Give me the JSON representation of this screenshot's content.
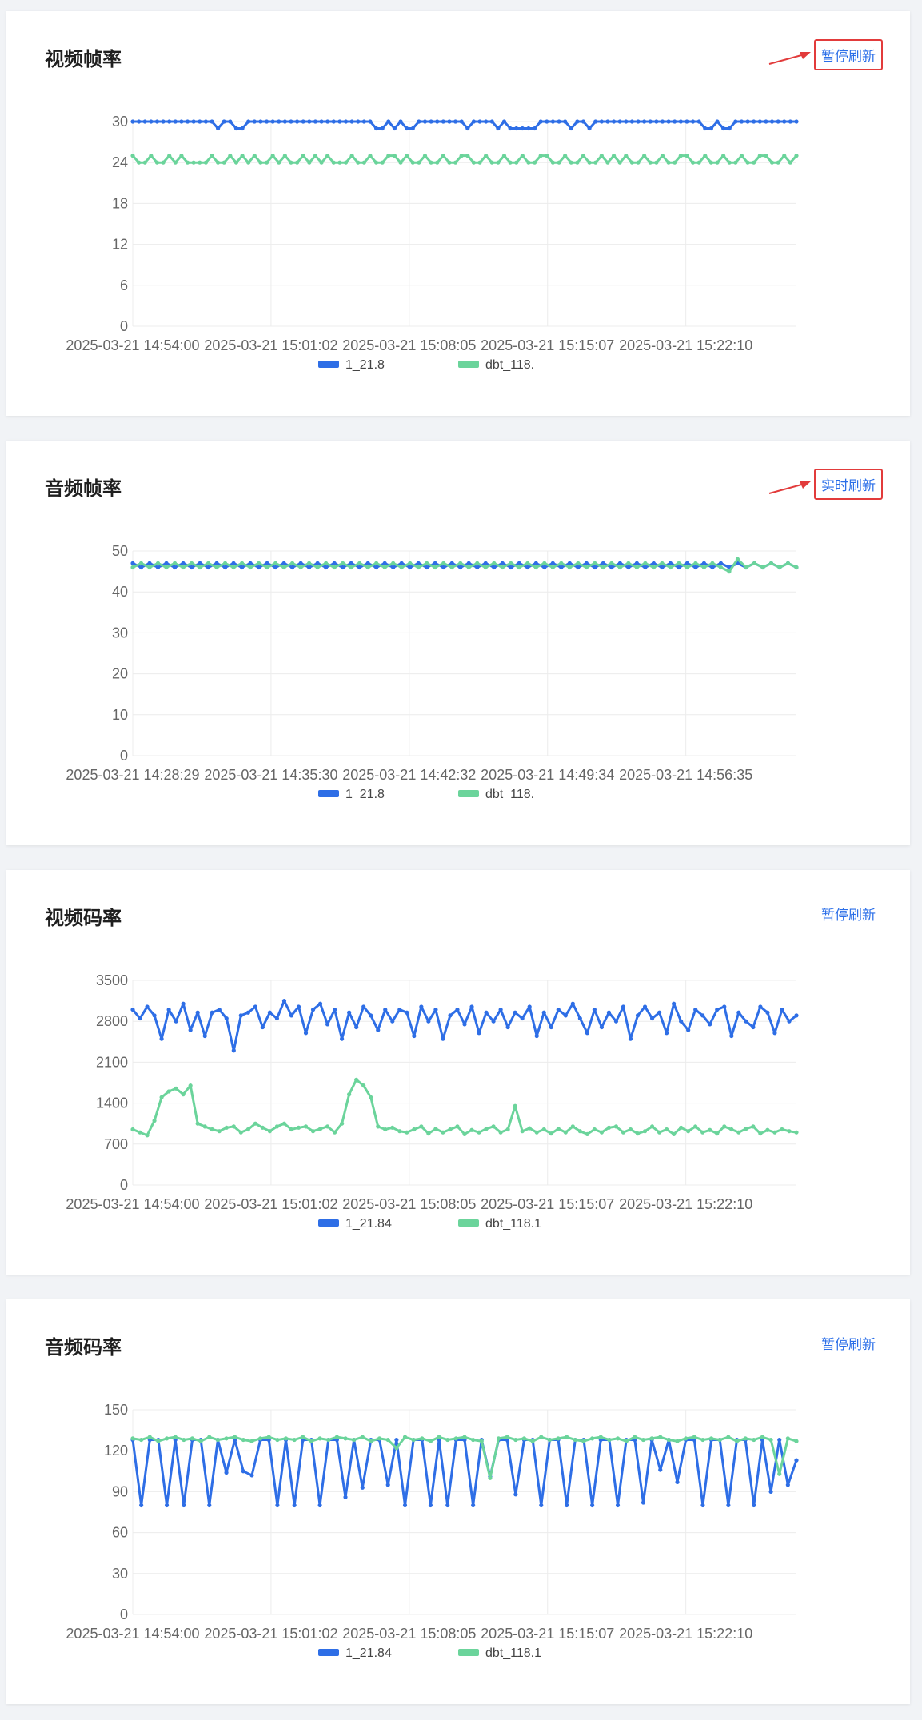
{
  "colors": {
    "series1": "#2e6ee6",
    "series2": "#6bd49b",
    "grid": "#ececec",
    "axis_text": "#666666",
    "accent": "#2a6ee8",
    "highlight": "#e23b3b"
  },
  "legend": [
    "1_21.8",
    "dbt_118."
  ],
  "panels": [
    {
      "title": "视频帧率",
      "button": "暂停刷新",
      "highlight": true
    },
    {
      "title": "音频帧率",
      "button": "实时刷新",
      "highlight": true
    },
    {
      "title": "视频码率",
      "button": "暂停刷新",
      "highlight": false
    },
    {
      "title": "音频码率",
      "button": "暂停刷新",
      "highlight": false
    }
  ],
  "chart_data": [
    {
      "type": "line",
      "title": "视频帧率",
      "y_ticks": [
        0,
        6,
        12,
        18,
        24,
        30
      ],
      "ylim": [
        0,
        30
      ],
      "x_ticks": [
        "2025-03-21 14:54:00",
        "2025-03-21 15:01:02",
        "2025-03-21 15:08:05",
        "2025-03-21 15:15:07",
        "2025-03-21 15:22:10"
      ],
      "legend_position": "bottom",
      "series": [
        {
          "name": "1_21.8",
          "baseline": 30,
          "dip": 29,
          "dips": [
            0.13,
            0.155,
            0.162,
            0.37,
            0.375,
            0.38,
            0.39,
            0.41,
            0.42,
            0.5,
            0.55,
            0.57,
            0.575,
            0.585,
            0.6,
            0.61,
            0.66,
            0.69,
            0.86,
            0.87,
            0.89,
            0.895
          ]
        },
        {
          "name": "dbt_118.",
          "baseline": 25,
          "dip": 24,
          "dips": [
            0.01,
            0.02,
            0.04,
            0.05,
            0.06,
            0.08,
            0.09,
            0.1,
            0.11,
            0.13,
            0.14,
            0.16,
            0.17,
            0.19,
            0.2,
            0.22,
            0.24,
            0.25,
            0.27,
            0.28,
            0.3,
            0.31,
            0.32,
            0.34,
            0.35,
            0.37,
            0.38,
            0.4,
            0.42,
            0.43,
            0.45,
            0.46,
            0.48,
            0.49,
            0.51,
            0.52,
            0.54,
            0.55,
            0.57,
            0.58,
            0.6,
            0.61,
            0.63,
            0.64,
            0.66,
            0.67,
            0.69,
            0.7,
            0.72,
            0.73,
            0.75,
            0.76,
            0.78,
            0.79,
            0.81,
            0.82,
            0.84,
            0.85,
            0.87,
            0.88,
            0.9,
            0.91,
            0.93,
            0.94,
            0.96,
            0.97,
            0.99
          ]
        }
      ]
    },
    {
      "type": "line",
      "title": "音频帧率",
      "y_ticks": [
        0,
        10,
        20,
        30,
        40,
        50
      ],
      "ylim": [
        0,
        50
      ],
      "x_ticks": [
        "2025-03-21 14:28:29",
        "2025-03-21 14:35:30",
        "2025-03-21 14:42:32",
        "2025-03-21 14:49:34",
        "2025-03-21 14:56:35"
      ],
      "legend_position": "bottom",
      "series": [
        {
          "name": "1_21.8",
          "values": [
            47,
            46,
            47,
            46,
            47,
            46,
            47,
            46,
            47,
            46,
            47,
            46,
            47,
            46,
            47,
            46,
            47,
            46,
            47,
            46,
            47,
            46,
            47,
            46,
            47,
            46,
            47,
            46,
            47,
            46,
            47,
            46,
            47,
            46,
            47,
            46,
            47,
            46,
            47,
            46,
            47,
            46,
            47,
            46,
            47,
            46,
            47,
            46,
            47,
            46,
            47,
            46,
            47,
            46,
            47,
            46,
            47,
            46,
            47,
            46,
            47,
            46,
            47,
            46,
            47,
            46,
            47,
            46,
            47,
            46,
            47,
            46,
            47,
            46,
            47,
            46,
            47,
            46,
            47,
            46
          ]
        },
        {
          "name": "dbt_118.",
          "values": [
            46,
            47,
            46,
            47,
            46,
            47,
            46,
            47,
            46,
            47,
            46,
            47,
            46,
            47,
            46,
            47,
            46,
            47,
            46,
            47,
            46,
            47,
            46,
            47,
            46,
            47,
            46,
            47,
            46,
            47,
            46,
            47,
            46,
            47,
            46,
            47,
            46,
            47,
            46,
            47,
            46,
            47,
            46,
            47,
            46,
            47,
            46,
            47,
            46,
            47,
            46,
            47,
            46,
            47,
            46,
            47,
            46,
            47,
            46,
            47,
            46,
            47,
            46,
            47,
            46,
            47,
            46,
            47,
            46,
            47,
            46,
            45,
            48,
            46,
            47,
            46,
            47,
            46,
            47,
            46
          ]
        }
      ]
    },
    {
      "type": "line",
      "title": "视频码率",
      "y_ticks": [
        0,
        700,
        1400,
        2100,
        2800,
        3500
      ],
      "ylim": [
        0,
        3500
      ],
      "x_ticks": [
        "2025-03-21 14:54:00",
        "2025-03-21 15:01:02",
        "2025-03-21 15:08:05",
        "2025-03-21 15:15:07",
        "2025-03-21 15:22:10"
      ],
      "legend_position": "bottom",
      "series": [
        {
          "name": "1_21.84",
          "values": [
            3000,
            2850,
            3050,
            2900,
            2500,
            3000,
            2800,
            3100,
            2650,
            2950,
            2550,
            2950,
            3000,
            2850,
            2300,
            2900,
            2950,
            3050,
            2700,
            2950,
            2850,
            3150,
            2900,
            3050,
            2600,
            3000,
            3100,
            2750,
            3000,
            2500,
            2950,
            2700,
            3050,
            2900,
            2650,
            3000,
            2800,
            3000,
            2950,
            2550,
            3050,
            2800,
            3000,
            2500,
            2900,
            3000,
            2750,
            3050,
            2600,
            2950,
            2800,
            3000,
            2700,
            2950,
            2850,
            3050,
            2550,
            2950,
            2700,
            3000,
            2900,
            3100,
            2850,
            2600,
            3000,
            2700,
            2950,
            2800,
            3050,
            2500,
            2900,
            3050,
            2850,
            2950,
            2600,
            3100,
            2800,
            2650,
            3000,
            2900,
            2750,
            3000,
            3050,
            2550,
            2950,
            2800,
            2700,
            3050,
            2950,
            2600,
            3000,
            2800,
            2900
          ]
        },
        {
          "name": "dbt_118.1",
          "values": [
            950,
            900,
            850,
            1100,
            1500,
            1600,
            1650,
            1550,
            1700,
            1050,
            1000,
            950,
            920,
            980,
            1000,
            900,
            950,
            1050,
            980,
            920,
            1000,
            1050,
            950,
            980,
            1000,
            920,
            960,
            1000,
            900,
            1050,
            1550,
            1800,
            1700,
            1500,
            1000,
            950,
            980,
            920,
            900,
            950,
            1000,
            880,
            960,
            900,
            950,
            1000,
            870,
            940,
            900,
            960,
            1000,
            900,
            950,
            1350,
            920,
            970,
            900,
            950,
            880,
            960,
            900,
            1000,
            920,
            870,
            950,
            900,
            980,
            1000,
            900,
            950,
            880,
            920,
            1000,
            900,
            950,
            870,
            980,
            920,
            1000,
            900,
            940,
            880,
            1000,
            950,
            900,
            960,
            1000,
            880,
            940,
            900,
            950,
            920,
            900
          ]
        }
      ]
    },
    {
      "type": "line",
      "title": "音频码率",
      "y_ticks": [
        0,
        30,
        60,
        90,
        120,
        150
      ],
      "ylim": [
        0,
        150
      ],
      "x_ticks": [
        "2025-03-21 14:54:00",
        "2025-03-21 15:01:02",
        "2025-03-21 15:08:05",
        "2025-03-21 15:15:07",
        "2025-03-21 15:22:10"
      ],
      "legend_position": "bottom",
      "series": [
        {
          "name": "1_21.84",
          "values": [
            128,
            80,
            128,
            128,
            80,
            128,
            80,
            128,
            128,
            80,
            128,
            104,
            128,
            105,
            102,
            128,
            128,
            80,
            128,
            80,
            128,
            128,
            80,
            128,
            128,
            86,
            128,
            93,
            128,
            128,
            95,
            128,
            80,
            128,
            128,
            80,
            128,
            80,
            128,
            128,
            80,
            128,
            101,
            128,
            128,
            88,
            128,
            128,
            80,
            128,
            128,
            80,
            128,
            128,
            80,
            128,
            128,
            80,
            128,
            128,
            82,
            128,
            106,
            128,
            97,
            128,
            128,
            80,
            128,
            128,
            80,
            128,
            128,
            80,
            128,
            90,
            128,
            95,
            113
          ]
        },
        {
          "name": "dbt_118.1",
          "values": [
            129,
            128,
            130,
            127,
            129,
            130,
            128,
            129,
            127,
            130,
            128,
            129,
            130,
            128,
            127,
            129,
            130,
            128,
            129,
            128,
            130,
            127,
            129,
            128,
            130,
            129,
            128,
            130,
            127,
            129,
            128,
            122,
            130,
            128,
            129,
            127,
            130,
            128,
            129,
            130,
            128,
            127,
            100,
            129,
            130,
            128,
            129,
            127,
            130,
            128,
            129,
            130,
            128,
            127,
            129,
            130,
            128,
            129,
            127,
            130,
            128,
            129,
            130,
            128,
            127,
            129,
            130,
            128,
            129,
            128,
            130,
            127,
            129,
            128,
            130,
            128,
            103,
            129,
            127
          ]
        }
      ]
    }
  ]
}
